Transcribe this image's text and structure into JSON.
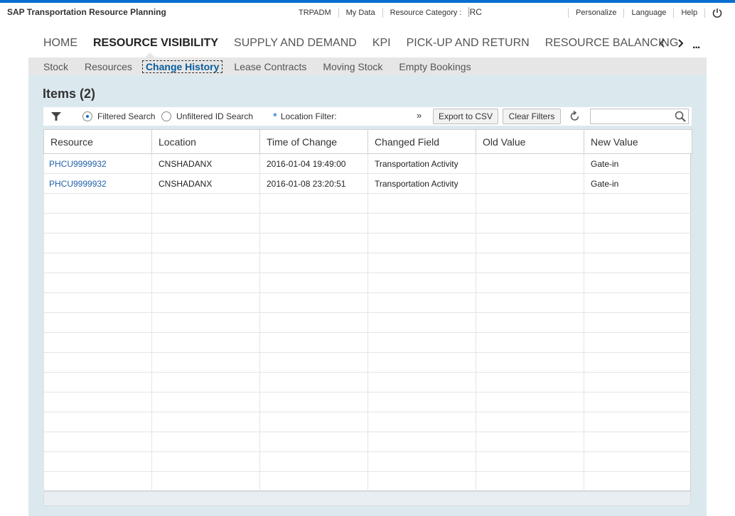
{
  "app_title": "SAP Transportation Resource Planning",
  "shell": {
    "user": "TRPADM",
    "my_data": "My Data",
    "resource_category_label": "Resource Category :",
    "resource_category_value": "RC",
    "personalize": "Personalize",
    "language": "Language",
    "help": "Help",
    "power_icon": "power-icon"
  },
  "main_nav": {
    "items": [
      "HOME",
      "RESOURCE VISIBILITY",
      "SUPPLY AND DEMAND",
      "KPI",
      "PICK-UP AND RETURN",
      "RESOURCE BALANCING"
    ],
    "active": "RESOURCE VISIBILITY",
    "prev_icon": "chevron-left-icon",
    "next_icon": "chevron-right-icon",
    "more": "..."
  },
  "sub_nav": {
    "items": [
      "Stock",
      "Resources",
      "Change History",
      "Lease Contracts",
      "Moving Stock",
      "Empty Bookings"
    ],
    "active": "Change History"
  },
  "items_title": "Items (2)",
  "toolbar": {
    "filter_icon": "filter-icon",
    "filtered_search": "Filtered Search",
    "unfiltered_search": "Unfiltered ID Search",
    "required_mark": "*",
    "location_filter": "Location Filter:",
    "expand": "»",
    "export_csv": "Export to CSV",
    "clear_filters": "Clear Filters",
    "refresh_icon": "refresh-icon",
    "search_placeholder": "",
    "search_icon": "search-icon",
    "selected_search_mode": "Filtered Search"
  },
  "table": {
    "columns": [
      "Resource",
      "Location",
      "Time of Change",
      "Changed Field",
      "Old Value",
      "New Value"
    ],
    "rows": [
      [
        "PHCU9999932",
        "CNSHADANX",
        "2016-01-04 19:49:00",
        "Transportation Activity",
        "",
        "Gate-in"
      ],
      [
        "PHCU9999932",
        "CNSHADANX",
        "2016-01-08 23:20:51",
        "Transportation Activity",
        "",
        "Gate-in"
      ]
    ],
    "empty_rows": 15
  },
  "colors": {
    "accent": "#0a6ed1",
    "link": "#2161a9",
    "panel_bg": "#dbe9ef",
    "subnav_bg": "#e6e6e6"
  }
}
